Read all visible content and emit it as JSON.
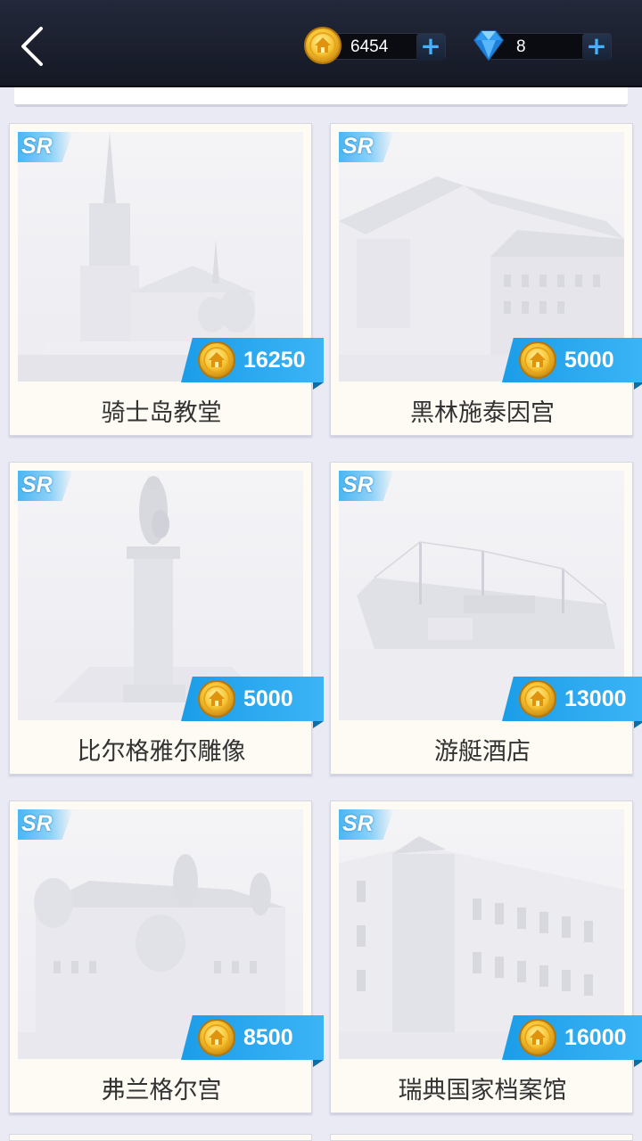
{
  "header": {
    "coins": "6454",
    "gems": "8",
    "plus_label": "+"
  },
  "colors": {
    "accent": "#2aa8f0",
    "header_bg": "#1c2130",
    "card_bg": "#fdfbf3"
  },
  "icons": {
    "back": "back-arrow-icon",
    "coin": "coin-icon",
    "gem": "diamond-icon"
  },
  "cards": [
    {
      "badge": "SR",
      "price": "16250",
      "title": "骑士岛教堂"
    },
    {
      "badge": "SR",
      "price": "5000",
      "title": "黑林施泰因宫"
    },
    {
      "badge": "SR",
      "price": "5000",
      "title": "比尔格雅尔雕像"
    },
    {
      "badge": "SR",
      "price": "13000",
      "title": "游艇酒店"
    },
    {
      "badge": "SR",
      "price": "8500",
      "title": "弗兰格尔宫"
    },
    {
      "badge": "SR",
      "price": "16000",
      "title": "瑞典国家档案馆"
    }
  ]
}
